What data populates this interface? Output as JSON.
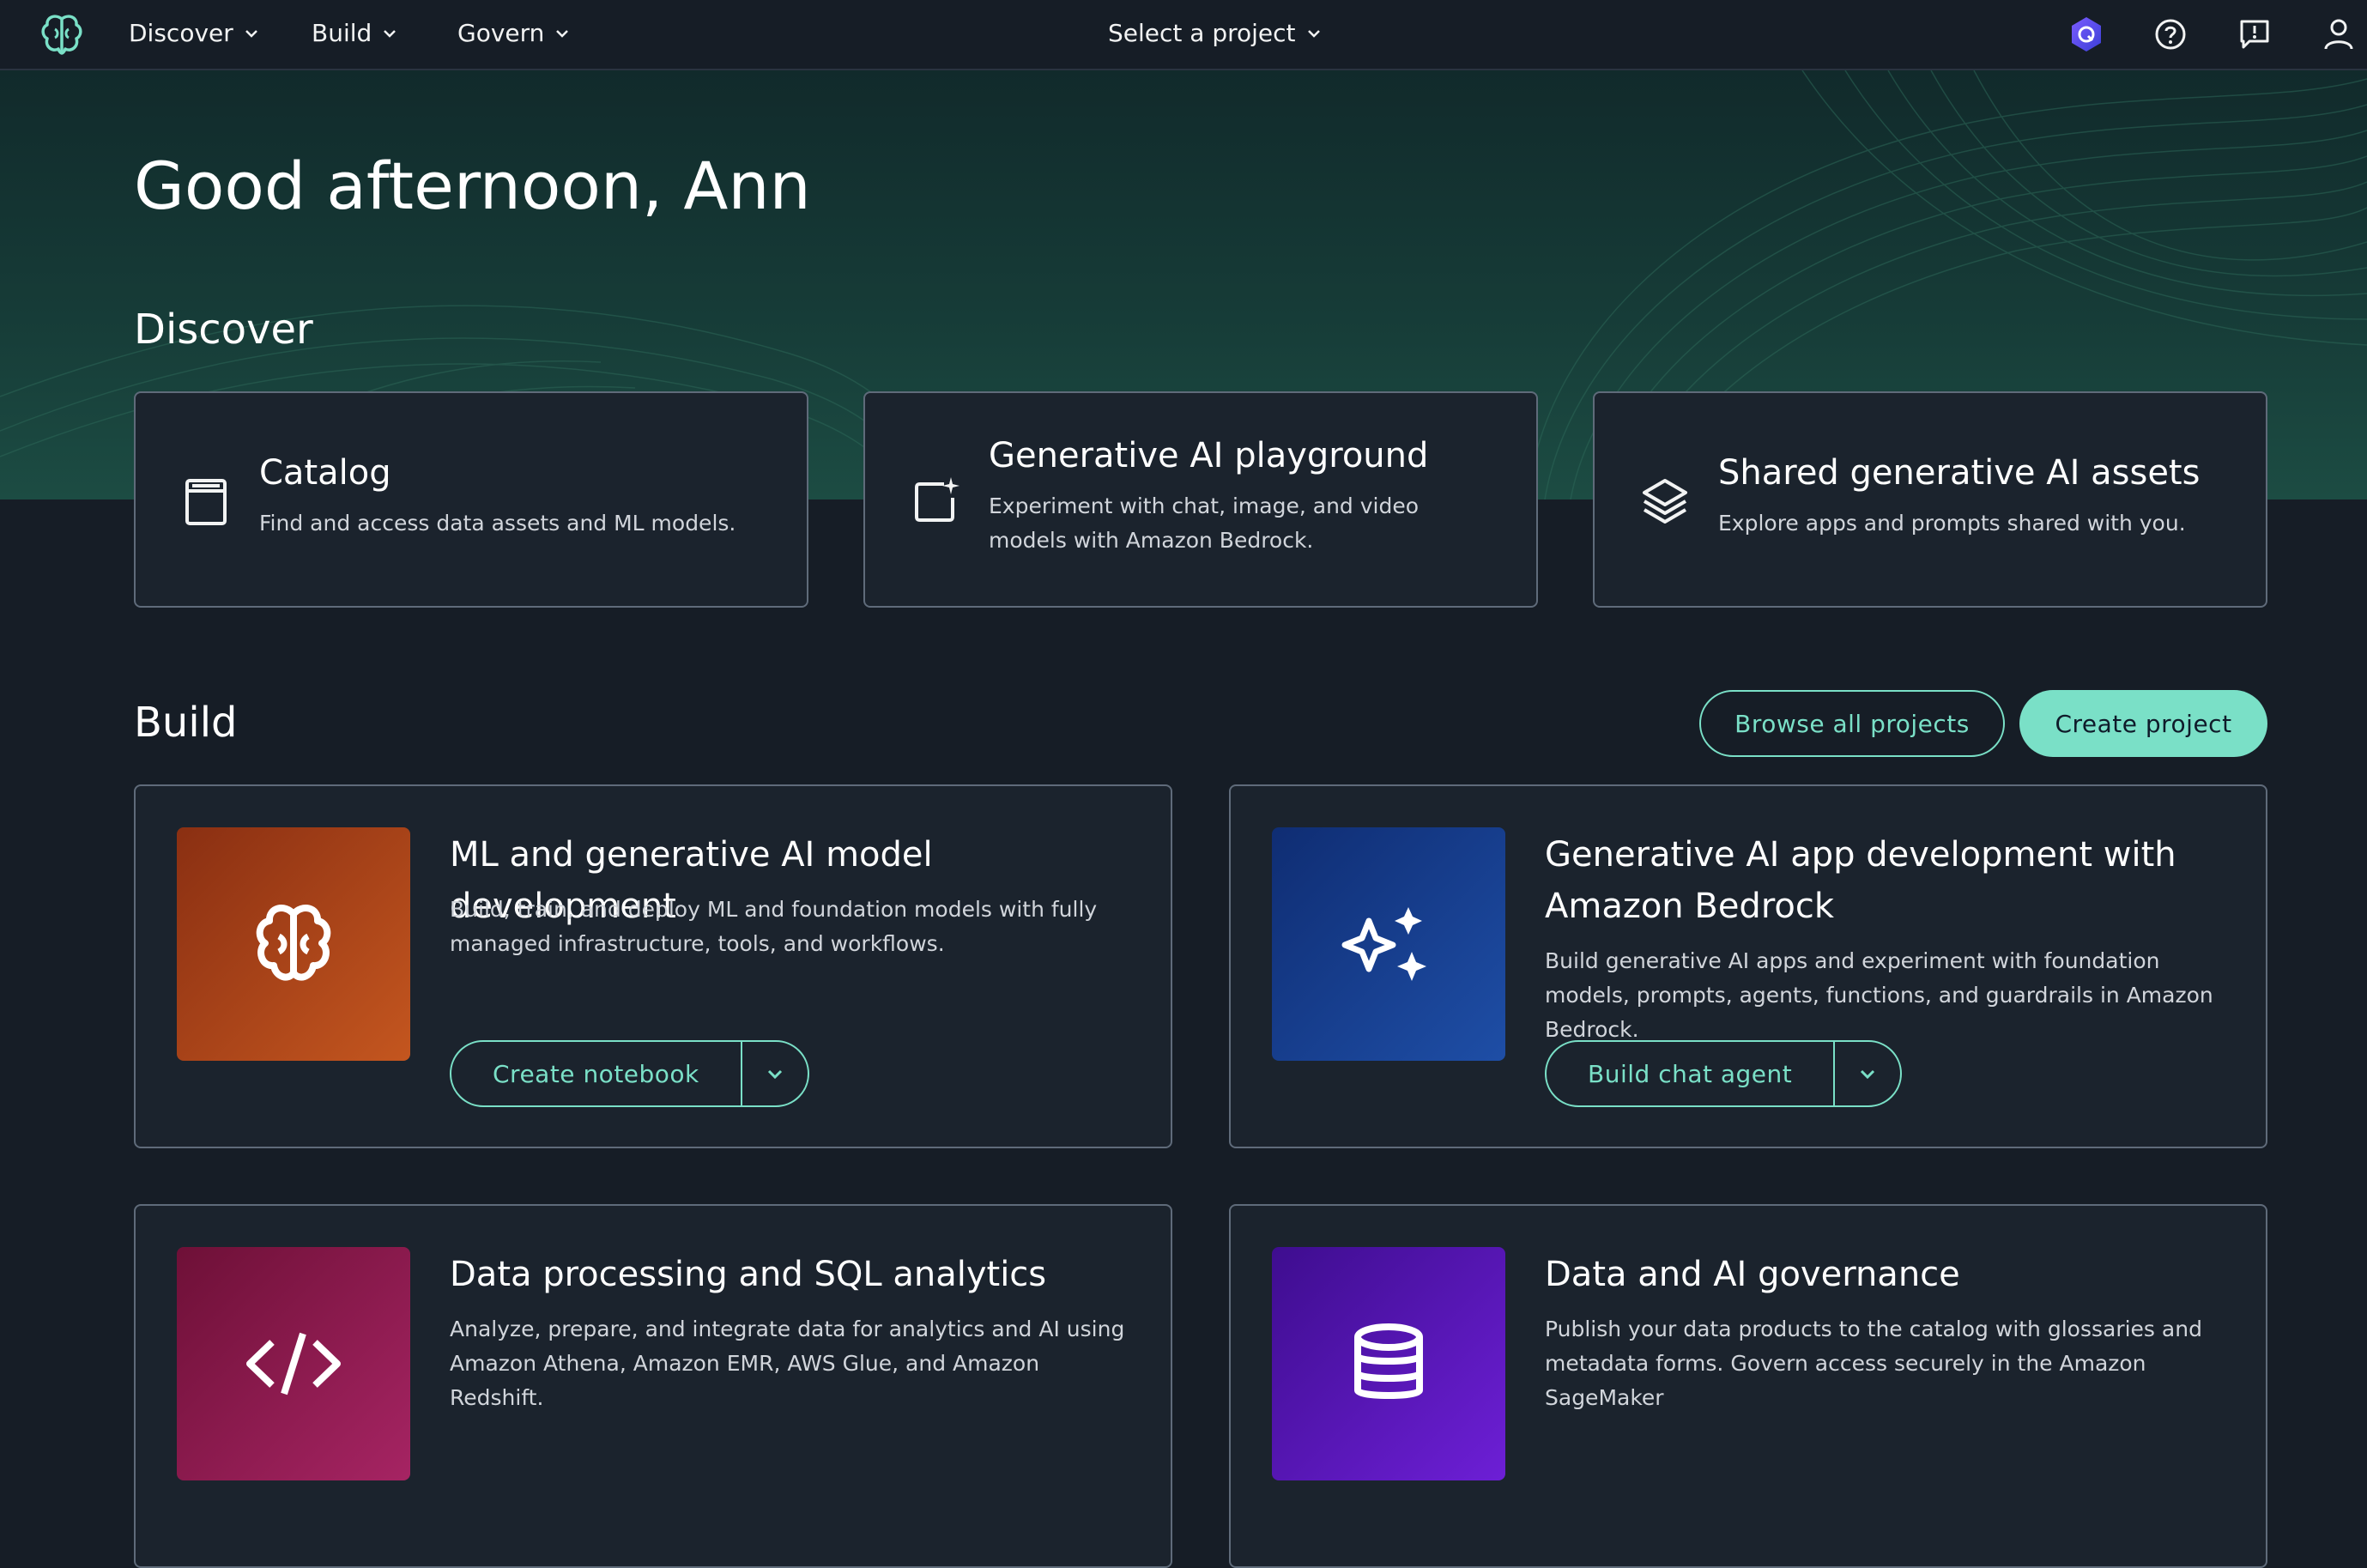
{
  "nav": {
    "menus": [
      "Discover",
      "Build",
      "Govern"
    ],
    "project_selector": "Select a project"
  },
  "hero": {
    "greeting": "Good afternoon, Ann"
  },
  "discover": {
    "title": "Discover",
    "cards": [
      {
        "title": "Catalog",
        "description": "Find and access data assets and ML models.",
        "icon": "catalog-icon"
      },
      {
        "title": "Generative AI playground",
        "description": "Experiment with chat, image, and video models with Amazon Bedrock.",
        "icon": "playground-icon"
      },
      {
        "title": "Shared generative AI assets",
        "description": "Explore apps and prompts shared with you.",
        "icon": "layers-icon"
      }
    ]
  },
  "build": {
    "title": "Build",
    "browse_label": "Browse all projects",
    "create_label": "Create project",
    "cards": [
      {
        "title": "ML and generative AI model development",
        "description": "Build, train, and deploy ML and foundation models with fully managed infrastructure, tools, and workflows.",
        "action": "Create notebook",
        "icon": "brain-icon",
        "color": "#b4491f"
      },
      {
        "title": "Generative AI app development with Amazon Bedrock",
        "description": "Build generative AI apps and experiment with foundation models, prompts, agents, functions, and guardrails in Amazon Bedrock.",
        "action": "Build chat agent",
        "icon": "sparkles-icon",
        "color": "#1a3f8f"
      },
      {
        "title": "Data processing and SQL analytics",
        "description": "Analyze, prepare, and integrate data for analytics and AI using Amazon Athena, Amazon EMR, AWS Glue, and Amazon Redshift.",
        "icon": "code-icon",
        "color": "#9b1e55"
      },
      {
        "title": "Data and AI governance",
        "description": "Publish your data products to the catalog with glossaries and metadata forms. Govern access securely in the Amazon SageMaker",
        "icon": "database-icon",
        "color": "#5a12b8"
      }
    ]
  },
  "colors": {
    "accent": "#7ae0c7",
    "background": "#161d26",
    "card": "#1b232d"
  }
}
